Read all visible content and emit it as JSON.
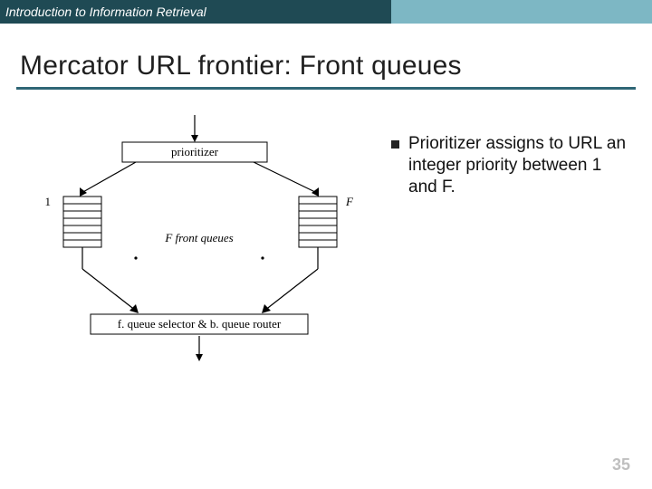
{
  "header": {
    "course": "Introduction to Information Retrieval"
  },
  "slide": {
    "title": "Mercator URL frontier: Front queues",
    "page_number": "35"
  },
  "diagram": {
    "box_prioritizer": "prioritizer",
    "left_queue_label": "1",
    "right_queue_label": "F",
    "mid_label": "F front queues",
    "box_router": "f. queue selector & b. queue router"
  },
  "bullets": [
    "Prioritizer assigns to URL an integer priority between 1 and F."
  ]
}
